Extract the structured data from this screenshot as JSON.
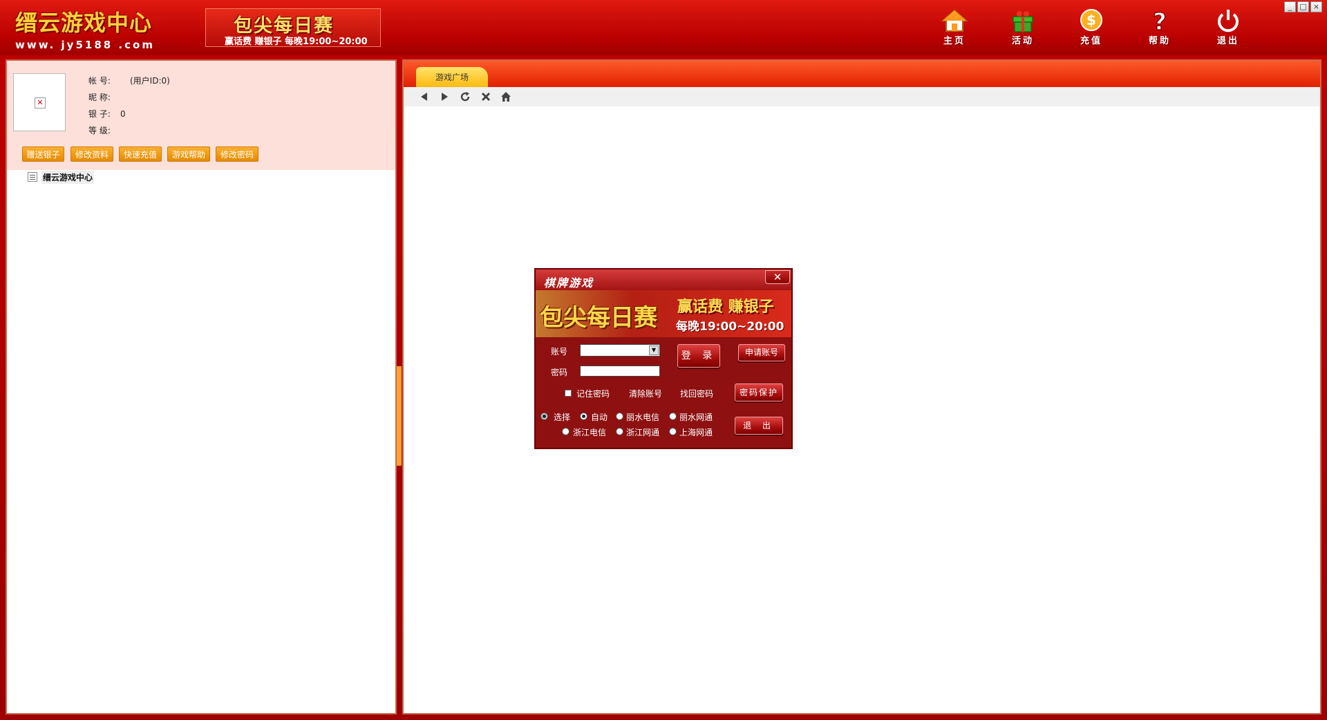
{
  "header": {
    "logo_title": "缙云游戏中心",
    "logo_url": "www. jy5188 .com",
    "banner_title": "包尖每日赛",
    "banner_subtitle": "赢话费 赚银子 每晚19:00~20:00",
    "nav": [
      {
        "label": "主页",
        "icon": "home-icon"
      },
      {
        "label": "活动",
        "icon": "gift-icon"
      },
      {
        "label": "充值",
        "icon": "coin-icon"
      },
      {
        "label": "帮助",
        "icon": "help-icon"
      },
      {
        "label": "退出",
        "icon": "power-icon"
      }
    ],
    "window_controls": [
      "_",
      "□",
      "×"
    ]
  },
  "user": {
    "account_label": "帐  号:",
    "account_value": "(用户ID:0)",
    "nickname_label": "昵  称:",
    "silver_label": "银  子:",
    "silver_value": "0",
    "level_label": "等  级:",
    "buttons": [
      "赠送银子",
      "修改资料",
      "快速充值",
      "游戏帮助",
      "修改密码"
    ]
  },
  "tree": {
    "root_label": "缙云游戏中心"
  },
  "tabs": [
    {
      "label": "游戏广场",
      "active": true
    }
  ],
  "toolbar": [
    "back-icon",
    "forward-icon",
    "refresh-icon",
    "stop-icon",
    "home-icon"
  ],
  "dialog": {
    "title": "棋牌游戏",
    "close_label": "✕",
    "banner_title": "包尖每日赛",
    "banner_line1": "赢话费 赚银子",
    "banner_line2": "每晚19:00~20:00",
    "account_label": "账号",
    "account_value": "",
    "password_label": "密码",
    "password_value": "",
    "login_button": "登 录",
    "register_button": "申请账号",
    "remember_label": "记住密码",
    "clear_label": "清除账号",
    "recover_label": "找回密码",
    "protect_button": "密码保护",
    "exit_button": "退  出",
    "select_label": "选择",
    "servers": [
      {
        "label": "自动",
        "checked": true
      },
      {
        "label": "丽水电信",
        "checked": false
      },
      {
        "label": "丽水网通",
        "checked": false
      },
      {
        "label": "浙江电信",
        "checked": false
      },
      {
        "label": "浙江网通",
        "checked": false
      },
      {
        "label": "上海网通",
        "checked": false
      }
    ]
  },
  "colors": {
    "header_red": "#c00000",
    "accent_orange": "#f5a000",
    "tab_yellow": "#ffd23a",
    "dialog_red": "#8e1010"
  }
}
